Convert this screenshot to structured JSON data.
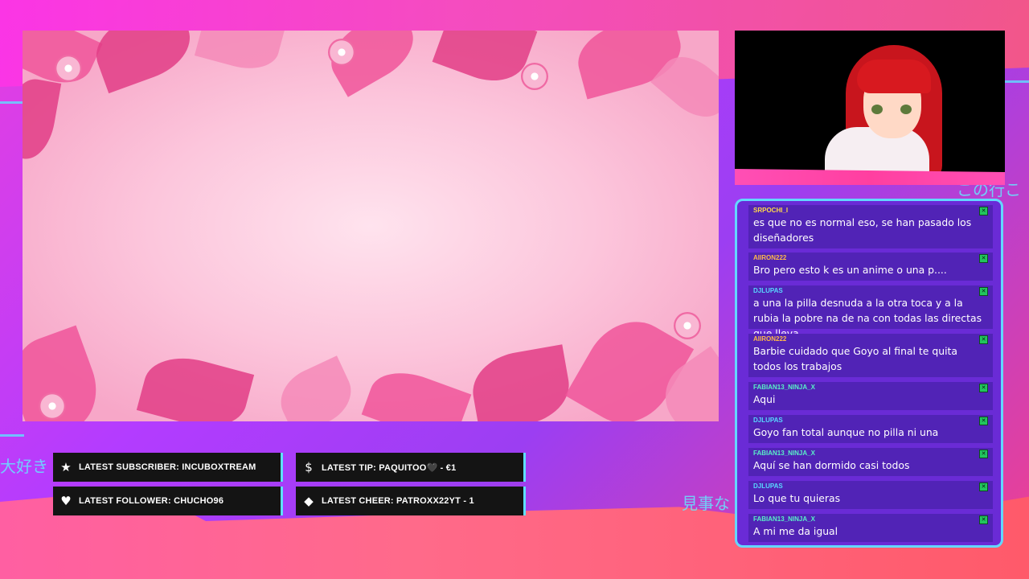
{
  "background": {
    "japanese_text_right": "この行こ",
    "japanese_text_left": "大好き",
    "japanese_text_bottom": "見事な"
  },
  "colors": {
    "chat_border": "#63d8ff",
    "chat_bg": "#6a2bd6",
    "message_bg": "#5123b6",
    "moderator_badge": "#22c55e",
    "alert_bg": "#141414",
    "alert_border": "#5ee0ff"
  },
  "chat": {
    "messages": [
      {
        "user": "SRPOCHI_I",
        "user_color": "#ffd84a",
        "text": "es que no es normal eso, se han pasado los diseñadores",
        "badge": "✕"
      },
      {
        "user": "AIIRON222",
        "user_color": "#ffb84a",
        "text": "Bro pero esto k es un anime o una p....",
        "badge": "✕"
      },
      {
        "user": "DJLUPAS",
        "user_color": "#59d7ff",
        "text": "a una la pilla desnuda a la otra toca y a la rubia la pobre na de na con todas las directas que lleva",
        "badge": "✕"
      },
      {
        "user": "AIIRON222",
        "user_color": "#ffb84a",
        "text": "Barbie cuidado que Goyo al final te quita todos los trabajos",
        "badge": "✕"
      },
      {
        "user": "FABIAN13_NINJA_X",
        "user_color": "#59f0c8",
        "text": "Aqui",
        "badge": "✕"
      },
      {
        "user": "DJLUPAS",
        "user_color": "#59d7ff",
        "text": "Goyo fan total aunque no pilla ni una",
        "badge": "✕"
      },
      {
        "user": "FABIAN13_NINJA_X",
        "user_color": "#59f0c8",
        "text": "Aquí se han dormido casi todos",
        "badge": "✕"
      },
      {
        "user": "DJLUPAS",
        "user_color": "#59d7ff",
        "text": "Lo que tu quieras",
        "badge": "✕"
      },
      {
        "user": "FABIAN13_NINJA_X",
        "user_color": "#59f0c8",
        "text": "A mi me da igual",
        "badge": "✕"
      }
    ]
  },
  "alerts": {
    "subscriber": {
      "icon": "star-icon",
      "label": "LATEST SUBSCRIBER: INCUBOXTREAM"
    },
    "tip": {
      "icon": "dollar-icon",
      "label": "LATEST TIP: PAQUITOO🖤 - €1"
    },
    "follower": {
      "icon": "heart-icon",
      "label": "LATEST FOLLOWER: CHUCHO96"
    },
    "cheer": {
      "icon": "diamond-icon",
      "label": "LATEST CHEER: PATROXX22YT - 1"
    }
  }
}
